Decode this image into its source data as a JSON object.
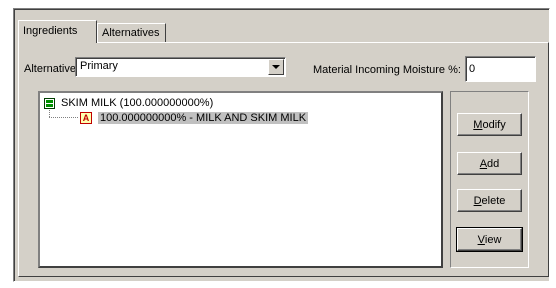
{
  "tabs": [
    {
      "label": "Ingredients",
      "active": true
    },
    {
      "label": "Alternatives",
      "active": false
    }
  ],
  "alternative": {
    "label": "Alternative:",
    "selected": "Primary"
  },
  "moisture": {
    "label": "Material Incoming Moisture %:",
    "value": "0"
  },
  "tree": {
    "root": {
      "label": "SKIM MILK (100.000000000%)",
      "icon": "bom-folder-icon"
    },
    "child": {
      "label": "100.000000000% - MILK AND SKIM MILK",
      "icon": "ingredient-a-icon",
      "icon_glyph": "A"
    }
  },
  "buttons": {
    "modify": {
      "mnemonic": "M",
      "rest": "odify"
    },
    "add": {
      "mnemonic": "A",
      "rest": "dd"
    },
    "delete": {
      "mnemonic": "D",
      "rest": "elete"
    },
    "view": {
      "mnemonic": "V",
      "rest": "iew"
    }
  }
}
